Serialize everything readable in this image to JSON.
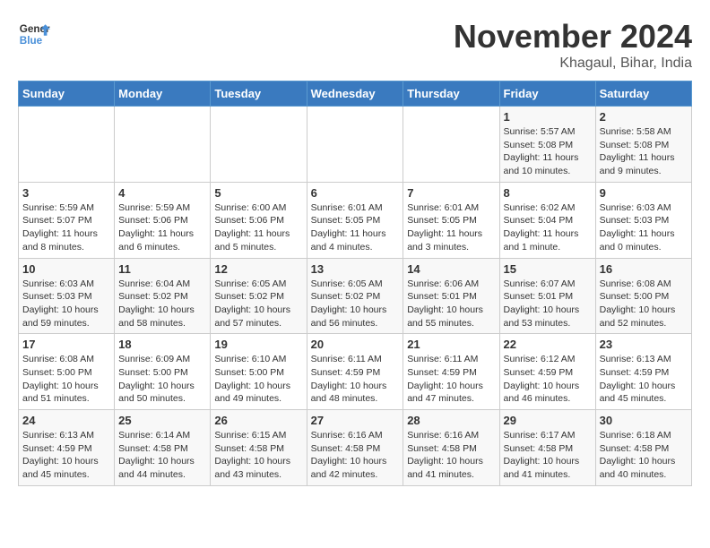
{
  "header": {
    "logo_line1": "General",
    "logo_line2": "Blue",
    "month_title": "November 2024",
    "location": "Khagaul, Bihar, India"
  },
  "weekdays": [
    "Sunday",
    "Monday",
    "Tuesday",
    "Wednesday",
    "Thursday",
    "Friday",
    "Saturday"
  ],
  "weeks": [
    [
      {
        "day": "",
        "info": ""
      },
      {
        "day": "",
        "info": ""
      },
      {
        "day": "",
        "info": ""
      },
      {
        "day": "",
        "info": ""
      },
      {
        "day": "",
        "info": ""
      },
      {
        "day": "1",
        "info": "Sunrise: 5:57 AM\nSunset: 5:08 PM\nDaylight: 11 hours and 10 minutes."
      },
      {
        "day": "2",
        "info": "Sunrise: 5:58 AM\nSunset: 5:08 PM\nDaylight: 11 hours and 9 minutes."
      }
    ],
    [
      {
        "day": "3",
        "info": "Sunrise: 5:59 AM\nSunset: 5:07 PM\nDaylight: 11 hours and 8 minutes."
      },
      {
        "day": "4",
        "info": "Sunrise: 5:59 AM\nSunset: 5:06 PM\nDaylight: 11 hours and 6 minutes."
      },
      {
        "day": "5",
        "info": "Sunrise: 6:00 AM\nSunset: 5:06 PM\nDaylight: 11 hours and 5 minutes."
      },
      {
        "day": "6",
        "info": "Sunrise: 6:01 AM\nSunset: 5:05 PM\nDaylight: 11 hours and 4 minutes."
      },
      {
        "day": "7",
        "info": "Sunrise: 6:01 AM\nSunset: 5:05 PM\nDaylight: 11 hours and 3 minutes."
      },
      {
        "day": "8",
        "info": "Sunrise: 6:02 AM\nSunset: 5:04 PM\nDaylight: 11 hours and 1 minute."
      },
      {
        "day": "9",
        "info": "Sunrise: 6:03 AM\nSunset: 5:03 PM\nDaylight: 11 hours and 0 minutes."
      }
    ],
    [
      {
        "day": "10",
        "info": "Sunrise: 6:03 AM\nSunset: 5:03 PM\nDaylight: 10 hours and 59 minutes."
      },
      {
        "day": "11",
        "info": "Sunrise: 6:04 AM\nSunset: 5:02 PM\nDaylight: 10 hours and 58 minutes."
      },
      {
        "day": "12",
        "info": "Sunrise: 6:05 AM\nSunset: 5:02 PM\nDaylight: 10 hours and 57 minutes."
      },
      {
        "day": "13",
        "info": "Sunrise: 6:05 AM\nSunset: 5:02 PM\nDaylight: 10 hours and 56 minutes."
      },
      {
        "day": "14",
        "info": "Sunrise: 6:06 AM\nSunset: 5:01 PM\nDaylight: 10 hours and 55 minutes."
      },
      {
        "day": "15",
        "info": "Sunrise: 6:07 AM\nSunset: 5:01 PM\nDaylight: 10 hours and 53 minutes."
      },
      {
        "day": "16",
        "info": "Sunrise: 6:08 AM\nSunset: 5:00 PM\nDaylight: 10 hours and 52 minutes."
      }
    ],
    [
      {
        "day": "17",
        "info": "Sunrise: 6:08 AM\nSunset: 5:00 PM\nDaylight: 10 hours and 51 minutes."
      },
      {
        "day": "18",
        "info": "Sunrise: 6:09 AM\nSunset: 5:00 PM\nDaylight: 10 hours and 50 minutes."
      },
      {
        "day": "19",
        "info": "Sunrise: 6:10 AM\nSunset: 5:00 PM\nDaylight: 10 hours and 49 minutes."
      },
      {
        "day": "20",
        "info": "Sunrise: 6:11 AM\nSunset: 4:59 PM\nDaylight: 10 hours and 48 minutes."
      },
      {
        "day": "21",
        "info": "Sunrise: 6:11 AM\nSunset: 4:59 PM\nDaylight: 10 hours and 47 minutes."
      },
      {
        "day": "22",
        "info": "Sunrise: 6:12 AM\nSunset: 4:59 PM\nDaylight: 10 hours and 46 minutes."
      },
      {
        "day": "23",
        "info": "Sunrise: 6:13 AM\nSunset: 4:59 PM\nDaylight: 10 hours and 45 minutes."
      }
    ],
    [
      {
        "day": "24",
        "info": "Sunrise: 6:13 AM\nSunset: 4:59 PM\nDaylight: 10 hours and 45 minutes."
      },
      {
        "day": "25",
        "info": "Sunrise: 6:14 AM\nSunset: 4:58 PM\nDaylight: 10 hours and 44 minutes."
      },
      {
        "day": "26",
        "info": "Sunrise: 6:15 AM\nSunset: 4:58 PM\nDaylight: 10 hours and 43 minutes."
      },
      {
        "day": "27",
        "info": "Sunrise: 6:16 AM\nSunset: 4:58 PM\nDaylight: 10 hours and 42 minutes."
      },
      {
        "day": "28",
        "info": "Sunrise: 6:16 AM\nSunset: 4:58 PM\nDaylight: 10 hours and 41 minutes."
      },
      {
        "day": "29",
        "info": "Sunrise: 6:17 AM\nSunset: 4:58 PM\nDaylight: 10 hours and 41 minutes."
      },
      {
        "day": "30",
        "info": "Sunrise: 6:18 AM\nSunset: 4:58 PM\nDaylight: 10 hours and 40 minutes."
      }
    ]
  ]
}
